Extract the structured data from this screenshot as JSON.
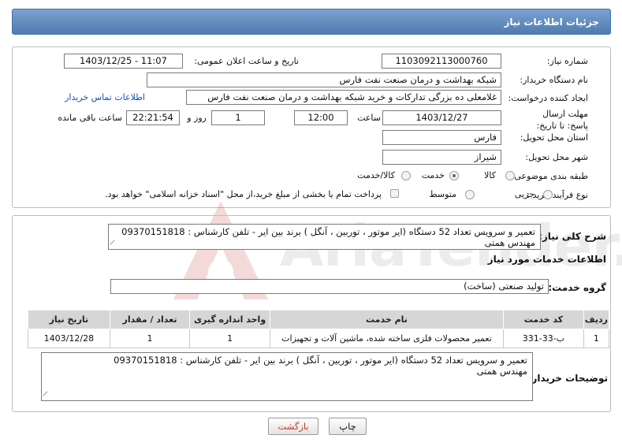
{
  "header": {
    "title": "جزئیات اطلاعات نیاز"
  },
  "form": {
    "need_number": {
      "label": "شماره نیاز:",
      "value": "1103092113000760"
    },
    "announce_datetime": {
      "label": "تاریخ و ساعت اعلان عمومی:",
      "value": "1403/12/25 - 11:07"
    },
    "buyer_org": {
      "label": "نام دستگاه خریدار:",
      "value": "شبکه بهداشت و درمان صنعت نفت فارس"
    },
    "requester": {
      "label": "ایجاد کننده درخواست:",
      "value": "غلامعلی ده بزرگی تدارکات و خرید شبکه بهداشت و درمان صنعت نفت فارس",
      "contact_link": "اطلاعات تماس خریدار"
    },
    "deadline": {
      "label": "مهلت ارسال پاسخ: تا تاریخ:",
      "date": "1403/12/27",
      "time_label": "ساعت",
      "time": "12:00",
      "days": "1",
      "days_label": "روز و",
      "remaining": "22:21:54",
      "remaining_label": "ساعت باقی مانده"
    },
    "province": {
      "label": "استان محل تحویل:",
      "value": "فارس"
    },
    "city": {
      "label": "شهر محل تحویل:",
      "value": "شیراز"
    },
    "category": {
      "label": "طبقه بندی موضوعی:",
      "options": [
        "کالا",
        "خدمت",
        "کالا/خدمت"
      ],
      "selected": "خدمت"
    },
    "process": {
      "label": "نوع فرآیند خرید :",
      "options": [
        "جزیی",
        "متوسط"
      ],
      "selected": "جزیی",
      "treasury_note": "پرداخت تمام یا بخشی از مبلغ خرید،از محل \"اسناد خزانه اسلامی\" خواهد بود."
    }
  },
  "summary": {
    "label": "شرح کلی نیاز:",
    "line1": "تعمیر و سرویس تعداد 52 دستگاه (ایر موتور ، توربین ، آنگل ) برند بین ایر - تلفن کارشناس : 09370151818",
    "line2": "مهندس همتی"
  },
  "services": {
    "section_title": "اطلاعات خدمات مورد نیاز",
    "group_label": "گروه خدمت:",
    "group_value": "تولید صنعتی (ساخت)",
    "columns": [
      "ردیف",
      "کد خدمت",
      "نام خدمت",
      "واحد اندازه گیری",
      "تعداد / مقدار",
      "تاریخ نیاز"
    ],
    "rows": [
      [
        "1",
        "ب-33-331",
        "تعمیر محصولات فلزی ساخته شده، ماشین آلات و تجهیزات",
        "1",
        "1",
        "1403/12/28"
      ]
    ]
  },
  "buyer_notes": {
    "label": "توضیحات خریدار:",
    "line1": "تعمیر و سرویس تعداد 52 دستگاه (ایر موتور ، توربین ، آنگل ) برند بین ایر - تلفن کارشناس : 09370151818",
    "line2": "مهندس همتی"
  },
  "buttons": {
    "print": "چاپ",
    "back": "بازگشت"
  },
  "watermark": {
    "text": "AriaTender.neT"
  }
}
